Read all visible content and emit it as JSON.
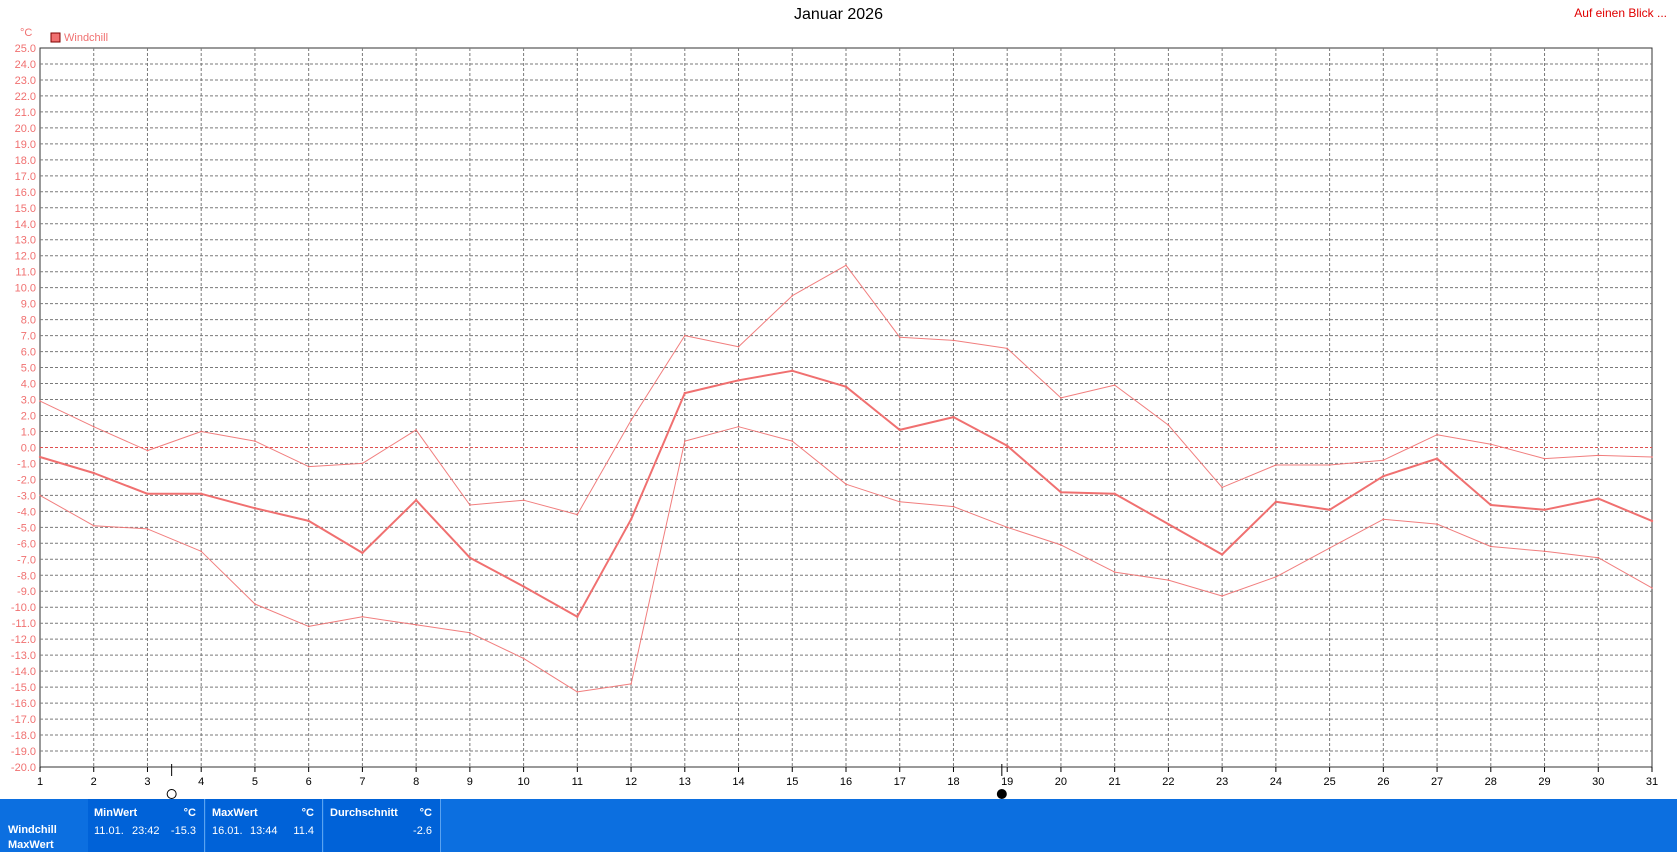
{
  "title": "Januar 2026",
  "link_label": "Auf einen Blick ...",
  "colors": {
    "series": "#f07070",
    "axis_text": "#f07070",
    "grid": "#7a7a7a",
    "bar_bg": "#0c6fe0",
    "panel_bg": "#0062d8",
    "link": "#e00000"
  },
  "chart_data": {
    "type": "line",
    "title": "Januar 2026",
    "y_unit_label": "°C",
    "legend": [
      {
        "name": "Windchill",
        "color": "#f07070"
      }
    ],
    "legend_position": "top-left",
    "grid": true,
    "ylim": [
      -20,
      25
    ],
    "xlim": [
      1,
      31
    ],
    "x": [
      1,
      2,
      3,
      4,
      5,
      6,
      7,
      8,
      9,
      10,
      11,
      12,
      13,
      14,
      15,
      16,
      17,
      18,
      19,
      20,
      21,
      22,
      23,
      24,
      25,
      26,
      27,
      28,
      29,
      30,
      31
    ],
    "y_tick_labels": [
      "25.0",
      "24.0",
      "23.0",
      "22.0",
      "21.0",
      "20.0",
      "19.0",
      "18.0",
      "17.0",
      "16.0",
      "15.0",
      "14.0",
      "13.0",
      "12.0",
      "11.0",
      "10.0",
      "9.0",
      "8.0",
      "7.0",
      "6.0",
      "5.0",
      "4.0",
      "3.0",
      "2.0",
      "1.0",
      "0.0",
      "-1.0",
      "-2.0",
      "-3.0",
      "-4.0",
      "-5.0",
      "-6.0",
      "-7.0",
      "-8.0",
      "-9.0",
      "-10.0",
      "-11.0",
      "-12.0",
      "-13.0",
      "-14.0",
      "-15.0",
      "-16.0",
      "-17.0",
      "-18.0",
      "-19.0",
      "-20.0"
    ],
    "x_tick_labels": [
      "1",
      "2",
      "3",
      "4",
      "5",
      "6",
      "7",
      "8",
      "9",
      "10",
      "11",
      "12",
      "13",
      "14",
      "15",
      "16",
      "17",
      "18",
      "19",
      "20",
      "21",
      "22",
      "23",
      "24",
      "25",
      "26",
      "27",
      "28",
      "29",
      "30",
      "31"
    ],
    "series": [
      {
        "name": "Windchill",
        "role": "average",
        "values": [
          -0.6,
          -1.6,
          -2.9,
          -2.9,
          -3.8,
          -4.6,
          -6.6,
          -3.3,
          -6.9,
          -8.7,
          -10.6,
          -4.5,
          3.4,
          4.2,
          4.8,
          3.8,
          1.1,
          1.9,
          0.1,
          -2.8,
          -2.9,
          -4.8,
          -6.7,
          -3.4,
          -3.9,
          -1.8,
          -0.7,
          -3.6,
          -3.9,
          -3.2,
          -4.6
        ]
      },
      {
        "role": "max",
        "values": [
          2.9,
          1.3,
          -0.2,
          1.0,
          0.4,
          -1.2,
          -1.0,
          1.1,
          -3.6,
          -3.3,
          -4.2,
          1.7,
          7.0,
          6.3,
          9.5,
          11.4,
          6.9,
          6.7,
          6.2,
          3.1,
          3.9,
          1.4,
          -2.5,
          -1.1,
          -1.1,
          -0.8,
          0.8,
          0.2,
          -0.7,
          -0.5,
          -0.6
        ]
      },
      {
        "role": "min",
        "values": [
          -3.0,
          -4.9,
          -5.1,
          -6.5,
          -9.8,
          -11.2,
          -10.6,
          -11.1,
          -11.6,
          -13.2,
          -15.3,
          -14.8,
          0.4,
          1.3,
          0.4,
          -2.3,
          -3.4,
          -3.7,
          -5.0,
          -6.1,
          -7.8,
          -8.3,
          -9.3,
          -8.1,
          -6.3,
          -4.5,
          -4.8,
          -6.2,
          -6.5,
          -6.9,
          -8.8
        ]
      }
    ],
    "markers": [
      {
        "x": 3.45,
        "type": "open"
      },
      {
        "x": 18.9,
        "type": "filled"
      }
    ]
  },
  "stats": {
    "row_labels": [
      "Windchill",
      "MaxWert"
    ],
    "min": {
      "header": "MinWert",
      "unit": "°C",
      "date": "11.01.",
      "time": "23:42",
      "value": "-15.3"
    },
    "max": {
      "header": "MaxWert",
      "unit": "°C",
      "date": "16.01.",
      "time": "13:44",
      "value": "11.4"
    },
    "avg": {
      "header": "Durchschnitt",
      "unit": "°C",
      "value": "-2.6"
    }
  }
}
